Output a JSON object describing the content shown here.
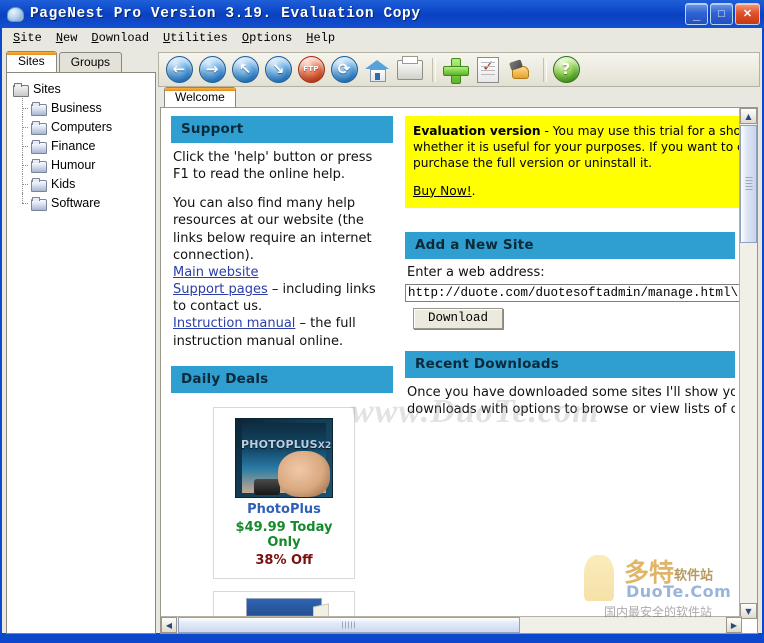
{
  "window": {
    "title": "PageNest Pro Version 3.19. Evaluation Copy",
    "app_icon": "globe-icon",
    "minimize_label": "_",
    "maximize_label": "□",
    "close_label": "✕"
  },
  "menubar": {
    "items": [
      {
        "label": "Site",
        "accel": "S",
        "rest": "ite"
      },
      {
        "label": "New",
        "accel": "N",
        "rest": "ew"
      },
      {
        "label": "Download",
        "accel": "D",
        "rest": "ownload"
      },
      {
        "label": "Utilities",
        "accel": "U",
        "rest": "tilities"
      },
      {
        "label": "Options",
        "accel": "O",
        "rest": "ptions"
      },
      {
        "label": "Help",
        "accel": "H",
        "rest": "elp"
      }
    ]
  },
  "toolbar": {
    "buttons": [
      {
        "name": "back-button",
        "icon": "arrow-left-icon",
        "glyph": "←"
      },
      {
        "name": "forward-button",
        "icon": "arrow-right-icon",
        "glyph": "→"
      },
      {
        "name": "up-button",
        "icon": "arrow-up-left-icon",
        "glyph": "↖"
      },
      {
        "name": "down-button",
        "icon": "arrow-down-right-icon",
        "glyph": "↘"
      },
      {
        "name": "stop-button",
        "icon": "stop-icon",
        "glyph": "FTP"
      },
      {
        "name": "refresh-button",
        "icon": "refresh-icon",
        "glyph": "⟳"
      },
      {
        "name": "home-button",
        "icon": "home-icon",
        "glyph": ""
      },
      {
        "name": "print-button",
        "icon": "printer-icon",
        "glyph": ""
      },
      {
        "name": "add-site-button",
        "icon": "plus-icon",
        "glyph": ""
      },
      {
        "name": "edit-list-button",
        "icon": "checklist-icon",
        "glyph": "✓"
      },
      {
        "name": "select-button",
        "icon": "hand-pointer-icon",
        "glyph": ""
      },
      {
        "name": "help-button",
        "icon": "help-icon",
        "glyph": "?"
      }
    ]
  },
  "sidebar": {
    "tabs": [
      {
        "label": "Sites",
        "active": true
      },
      {
        "label": "Groups",
        "active": false
      }
    ],
    "tree": {
      "root": {
        "label": "Sites",
        "icon": "folders-icon"
      },
      "children": [
        {
          "label": "Business",
          "icon": "folder-icon"
        },
        {
          "label": "Computers",
          "icon": "folder-icon"
        },
        {
          "label": "Finance",
          "icon": "folder-icon"
        },
        {
          "label": "Humour",
          "icon": "folder-icon"
        },
        {
          "label": "Kids",
          "icon": "folder-icon"
        },
        {
          "label": "Software",
          "icon": "folder-icon"
        }
      ]
    }
  },
  "document_tabs": [
    {
      "label": "Welcome",
      "active": true
    }
  ],
  "page": {
    "support": {
      "heading": "Support",
      "para1": "Click the 'help' button or press F1 to read the online help.",
      "para2": "You can also find many help resources at our website (the links below require an internet connection).",
      "link_main": "Main website",
      "link_support": "Support pages",
      "support_suffix": " – including links to contact us.",
      "link_manual": "Instruction manual",
      "manual_suffix": " – the full instruction manual online."
    },
    "evaluation": {
      "strong": "Evaluation version",
      "line1": " - You may use this trial for a short p",
      "line2": "whether it is useful for your purposes. If you want to conti",
      "line3": "purchase the full version or uninstall it.",
      "buy_link": "Buy Now!",
      "buy_suffix": "."
    },
    "add_site": {
      "heading": "Add a New Site",
      "label": "Enter a web address:",
      "url_value": "http://duote.com/duotesoftadmin/manage.html\\",
      "url_placeholder": "Enter a web address",
      "download_button": "Download"
    },
    "recent_downloads": {
      "heading": "Recent Downloads",
      "line1": "Once you have downloaded some sites I'll show you",
      "line2": "downloads with options to browse or view lists of c"
    },
    "daily_deals": {
      "heading": "Daily Deals",
      "items": [
        {
          "title_line": "PHOTOPLUS",
          "title_sup": "X2",
          "name": "PhotoPlus",
          "price": "$49.99 Today Only",
          "discount": "38% Off"
        }
      ]
    }
  },
  "watermarks": {
    "main": "www.DuoTe.com",
    "corner_cn": "多特",
    "corner_cn_small": "软件站",
    "corner_domain": "DuoTe.Com",
    "corner_sub": "国内最安全的软件站"
  },
  "scrollbars": {
    "up_arrow": "▲",
    "down_arrow": "▼",
    "left_arrow": "◀",
    "right_arrow": "▶"
  },
  "colors": {
    "titlebar": "#0b48cc",
    "section_header": "#2f9ed0",
    "evaluation_bg": "#ffff00",
    "link": "#2b3ea8",
    "price_green": "#148a2b",
    "discount_red": "#7a1010",
    "tab_accent": "#e98a1d"
  }
}
